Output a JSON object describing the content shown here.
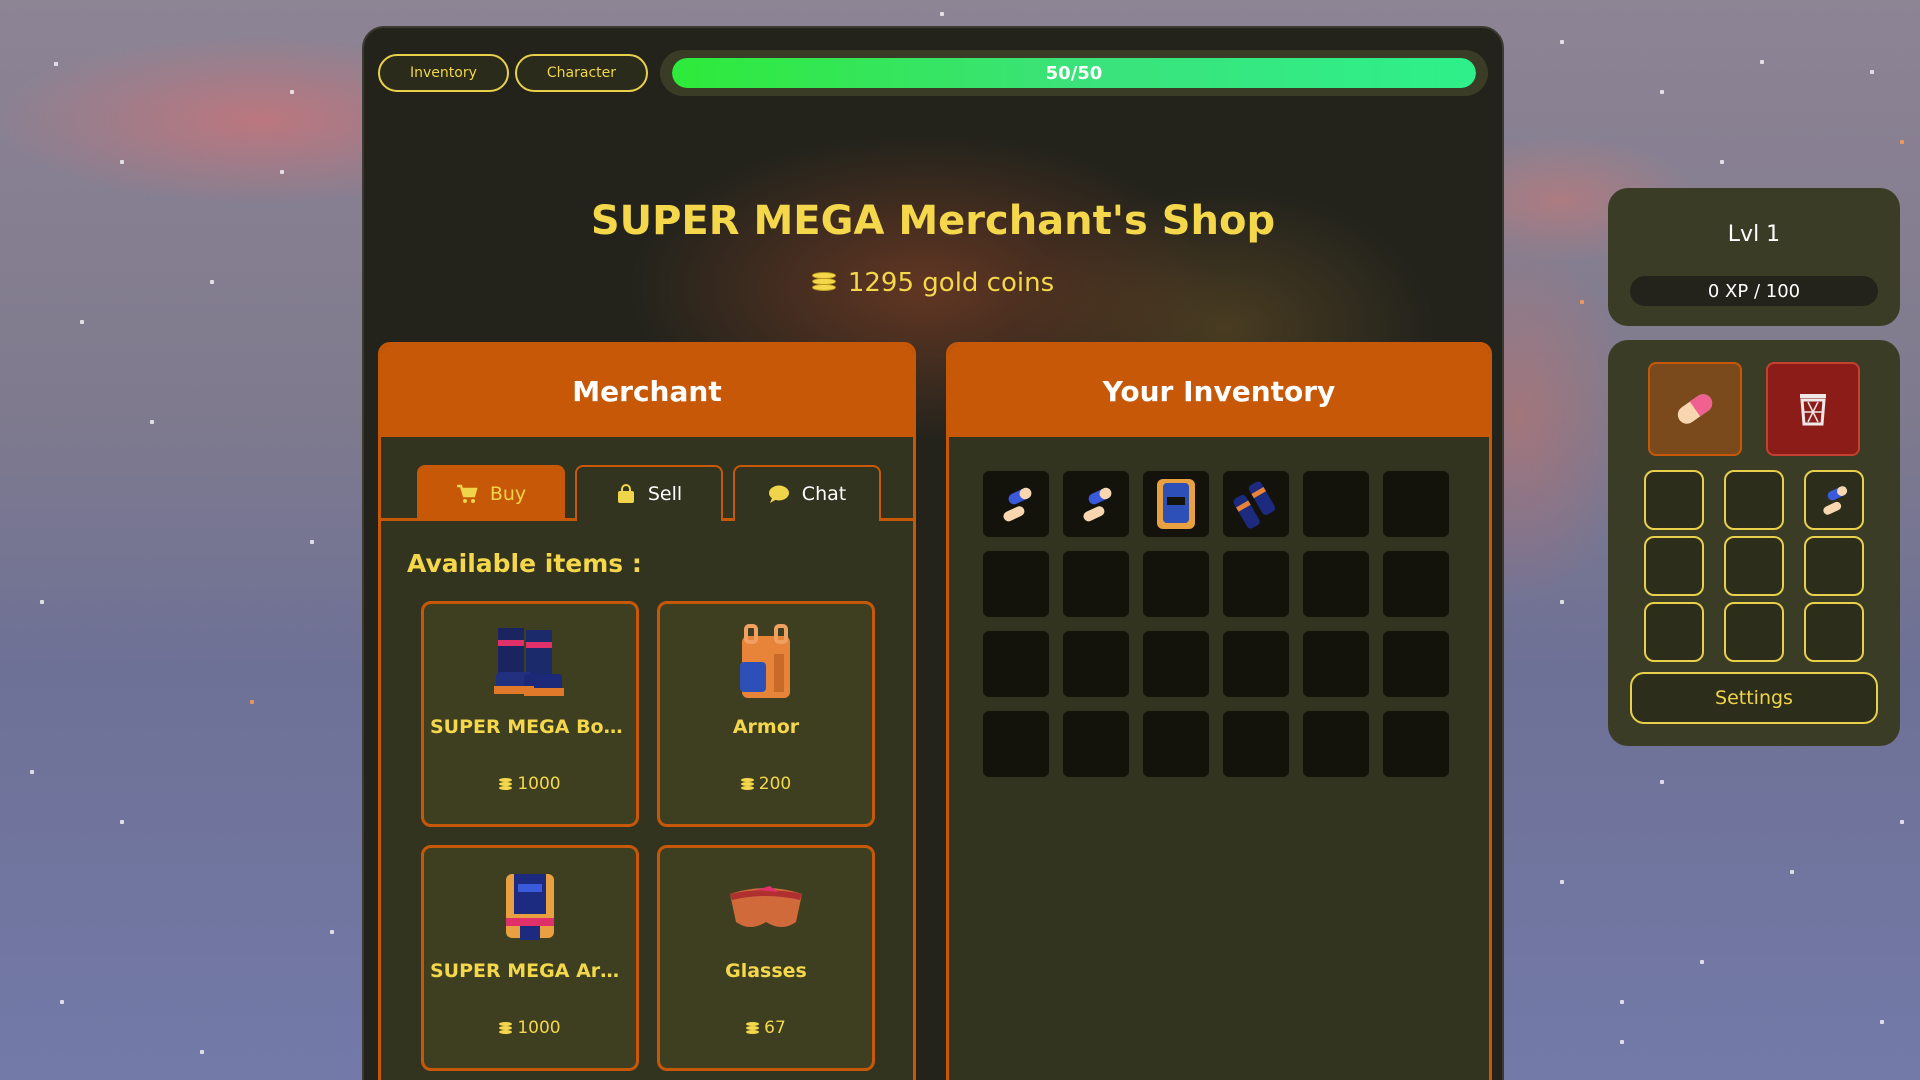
{
  "topbar": {
    "inventory_label": "Inventory",
    "character_label": "Character",
    "health": {
      "current": 50,
      "max": 50,
      "text": "50/50",
      "fill_fraction": 1.0
    }
  },
  "shop": {
    "title": "SUPER MEGA Merchant's Shop",
    "gold_text": "1295 gold coins",
    "gold_icon": "coin-stack-icon"
  },
  "merchant": {
    "heading": "Merchant",
    "tabs": [
      {
        "label": "Buy",
        "icon": "cart-icon",
        "active": true
      },
      {
        "label": "Sell",
        "icon": "bag-icon",
        "active": false
      },
      {
        "label": "Chat",
        "icon": "chat-bubble-icon",
        "active": false
      }
    ],
    "available_label": "Available items :",
    "items": [
      {
        "name": "SUPER MEGA Boots",
        "price": "1000",
        "icon": "boots-icon"
      },
      {
        "name": "Armor",
        "price": "200",
        "icon": "backpack-armor-icon"
      },
      {
        "name": "SUPER MEGA Armor",
        "price": "1000",
        "icon": "mega-armor-icon"
      },
      {
        "name": "Glasses",
        "price": "67",
        "icon": "glasses-icon"
      }
    ]
  },
  "inventory": {
    "heading": "Your Inventory",
    "slots": [
      "pill-icon",
      "pill-icon",
      "mega-armor-icon",
      "gloves-icon",
      "",
      "",
      "",
      "",
      "",
      "",
      "",
      "",
      "",
      "",
      "",
      "",
      "",
      "",
      "",
      "",
      "",
      "",
      "",
      ""
    ]
  },
  "player": {
    "level_text": "Lvl 1",
    "xp_text": "0 XP / 100"
  },
  "equipment": {
    "use_slot_icon": "pill-icon",
    "trash_icon": "trash-icon",
    "quick_slots": [
      "",
      "",
      "pill-icon",
      "",
      "",
      "",
      "",
      "",
      ""
    ],
    "settings_label": "Settings"
  },
  "colors": {
    "accent_orange": "#c75808",
    "gold_text": "#f4d74a",
    "health_green": "#2eea3a",
    "panel_dark": "#23231c",
    "trash_red": "#8c1c18"
  }
}
